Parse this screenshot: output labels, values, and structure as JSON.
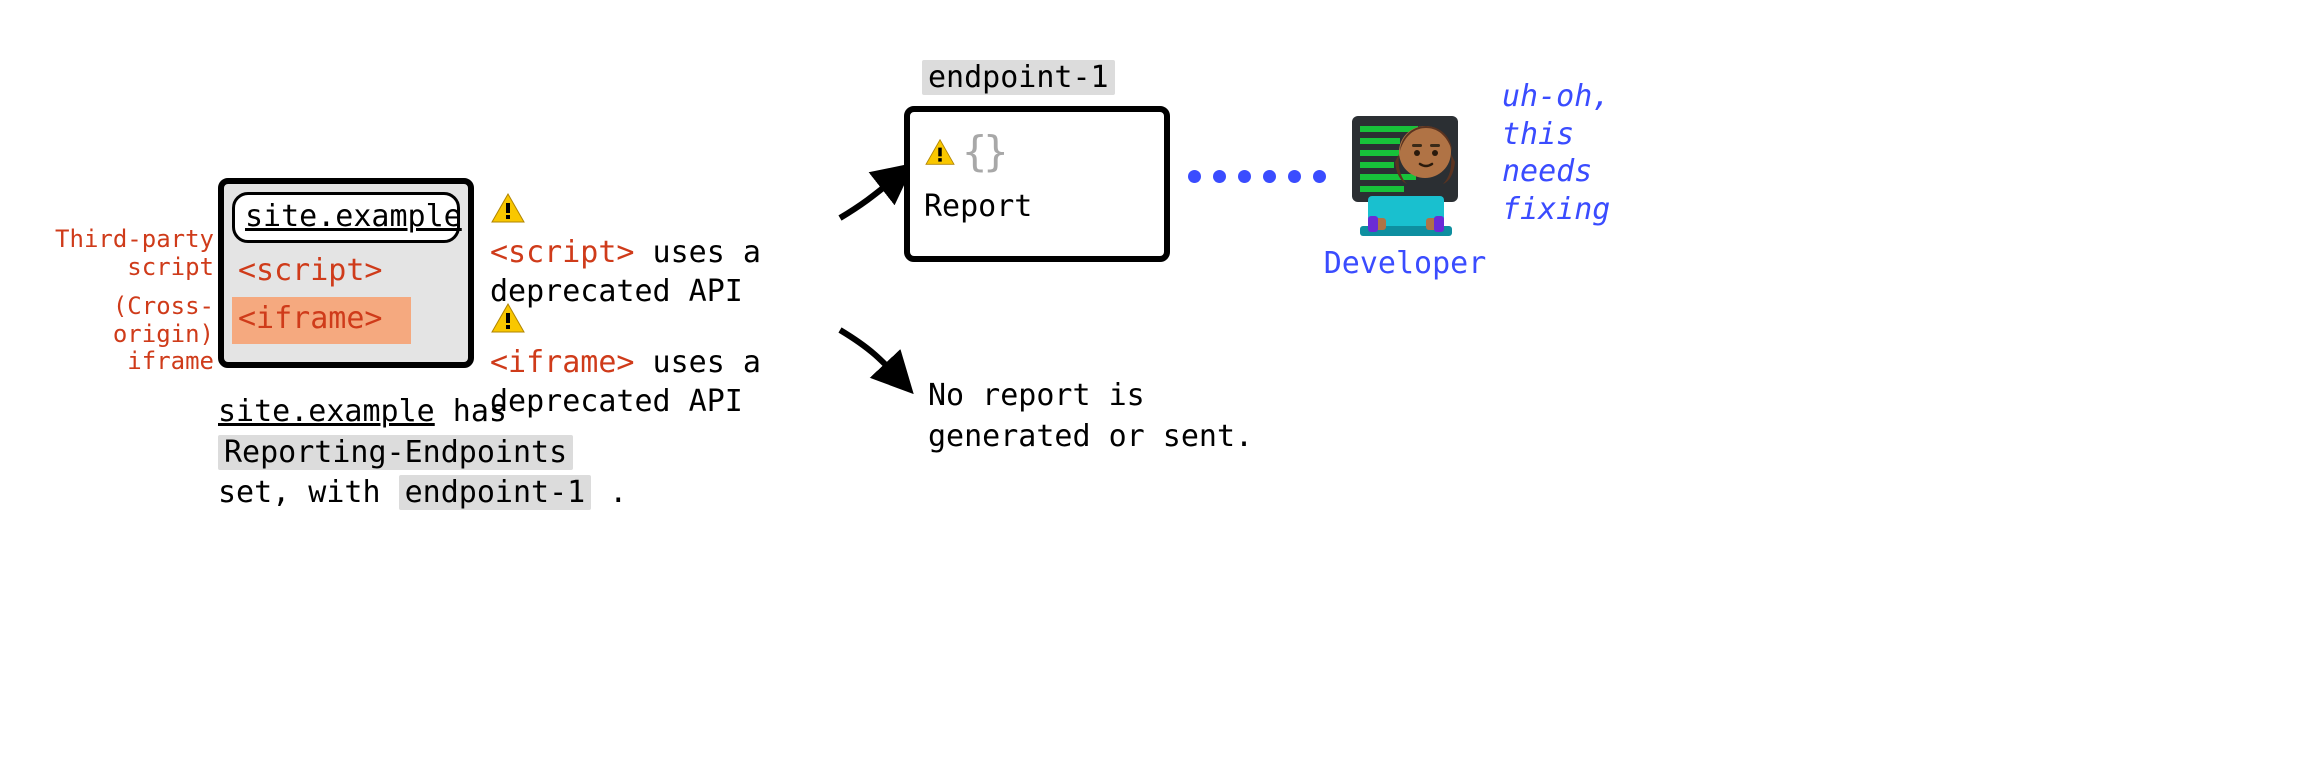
{
  "site": {
    "url": "site.example",
    "script_tag": "<script>",
    "iframe_tag": "<iframe>",
    "label_script_1": "Third-party",
    "label_script_2": "script",
    "label_iframe_1": "(Cross-origin)",
    "label_iframe_2": "iframe",
    "caption_1a": "site.example",
    "caption_1b": " has",
    "caption_2_hl": "Reporting-Endpoints",
    "caption_3a": "set, with ",
    "caption_3_hl": "endpoint-1",
    "caption_3b": " ."
  },
  "warnings": {
    "w1_a": "<script>",
    "w1_b": " uses a deprecated API",
    "w2_a": "<iframe>",
    "w2_b": " uses a deprecated API"
  },
  "endpoint": {
    "label": "endpoint-1",
    "report_label": "Report"
  },
  "no_report": "No report is generated or sent.",
  "developer": {
    "label": "Developer",
    "quote_1": "uh-oh,",
    "quote_2": "this",
    "quote_3": "needs",
    "quote_4": "fixing"
  }
}
